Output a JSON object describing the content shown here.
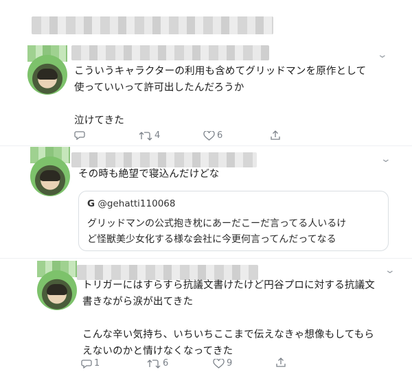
{
  "tweets": [
    {
      "text": "こういうキャラクターの利用も含めてグリッドマンを原作として\n使っていいって許可出したんだろうか\n\n泣けてきた",
      "actions": {
        "reply": "",
        "retweet": "4",
        "like": "6"
      }
    },
    {
      "text": "その時も絶望で寝込んだけどな",
      "quote": {
        "icon": "G",
        "handle": "@gehatti110068",
        "text": "グリッドマンの公式抱き枕にあーだこーだ言ってる人いるけ\nど怪獣美少女化する様な会社に今更何言ってんだってなる"
      }
    },
    {
      "text": "トリガーにはすらすら抗議文書けたけど円谷プロに対する抗議文\n書きながら涙が出てきた\n\nこんな辛い気持ち、いちいちここまで伝えなきゃ想像もしてもら\nえないのかと情けなくなってきた",
      "actions": {
        "reply": "1",
        "retweet": "6",
        "like": "9"
      }
    }
  ],
  "icons": [
    "reply-icon",
    "retweet-icon",
    "like-icon",
    "share-icon",
    "chevron-down-icon"
  ]
}
